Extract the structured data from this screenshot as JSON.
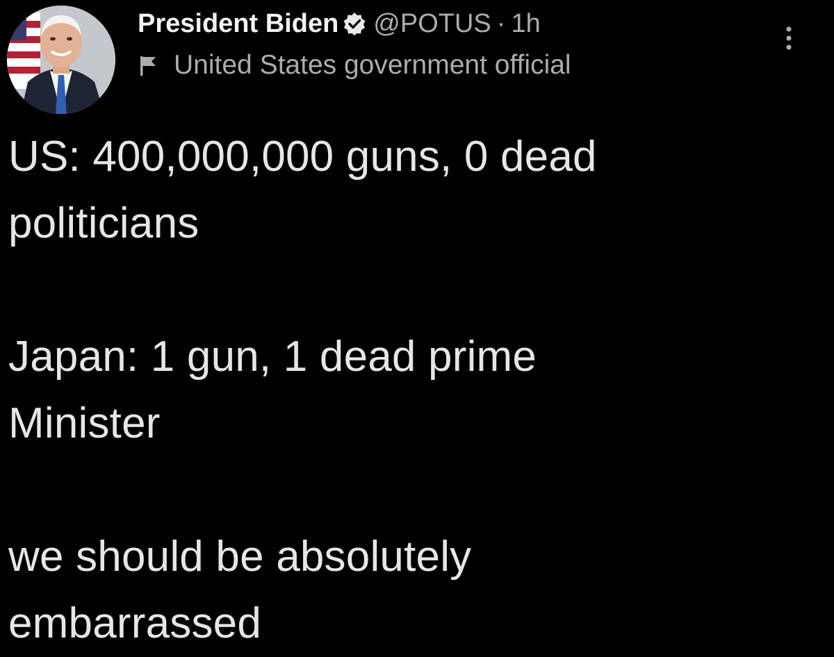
{
  "tweet": {
    "author": {
      "display_name": "President Biden",
      "handle": "@POTUS",
      "separator": "·",
      "time": "1h",
      "label": "United States government official",
      "avatar_icon": "avatar-portrait",
      "verified_icon": "verified-badge-icon",
      "label_icon": "flag-icon"
    },
    "more_icon": "more-options-icon",
    "text_lines": [
      "US: 400,000,000 guns, 0 dead",
      "politicians",
      "",
      "Japan: 1 gun, 1 dead prime",
      "Minister",
      "",
      "we should be absolutely",
      "embarrassed"
    ]
  },
  "colors": {
    "background": "#000000",
    "text": "#e7e9ea",
    "muted": "#a9adb1"
  }
}
